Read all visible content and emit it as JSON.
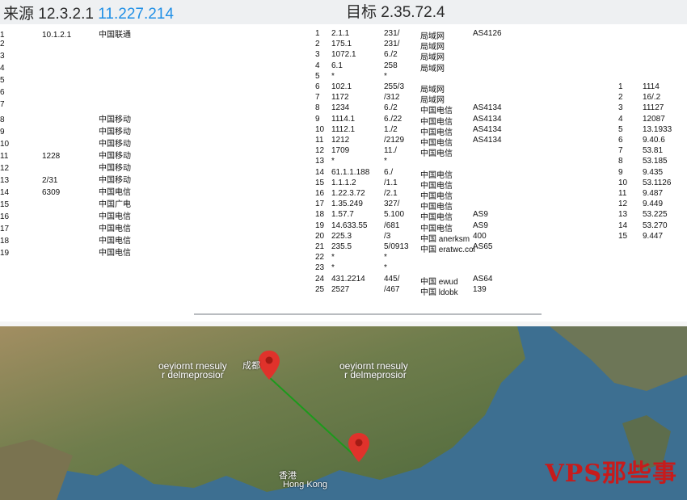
{
  "header": {
    "source_prefix": "来源",
    "source_ip_plain": "12.3.2.1",
    "source_ip_highlight": "11.227.214",
    "target_prefix": "目标",
    "target_ip": "2.35.72.4"
  },
  "left_table": [
    {
      "hop": "1",
      "ip": "10.1.2.1",
      "asn": "",
      "isp": "中国联通"
    },
    {
      "hop": "2",
      "ip": "",
      "asn": "",
      "isp": ""
    },
    {
      "hop": "3",
      "ip": "",
      "asn": "",
      "isp": ""
    },
    {
      "hop": "4",
      "ip": "",
      "asn": "",
      "isp": ""
    },
    {
      "hop": "5",
      "ip": "",
      "asn": "",
      "isp": ""
    },
    {
      "hop": "6",
      "ip": "",
      "asn": "",
      "isp": ""
    },
    {
      "hop": "7",
      "ip": "",
      "asn": "",
      "isp": ""
    },
    {
      "hop": "8",
      "ip": "",
      "asn": "",
      "isp": "中国移动"
    },
    {
      "hop": "9",
      "ip": "",
      "asn": "",
      "isp": "中国移动"
    },
    {
      "hop": "10",
      "ip": "",
      "asn": "",
      "isp": "中国移动"
    },
    {
      "hop": "11",
      "ip": "1228",
      "asn": "",
      "isp": "中国移动"
    },
    {
      "hop": "12",
      "ip": "",
      "asn": "",
      "isp": "中国移动"
    },
    {
      "hop": "13",
      "ip": "2/31",
      "asn": "",
      "isp": "中国移动"
    },
    {
      "hop": "14",
      "ip": "6309",
      "asn": "",
      "isp": "中国电信"
    },
    {
      "hop": "15",
      "ip": "",
      "asn": "",
      "isp": "中国广电"
    },
    {
      "hop": "16",
      "ip": "",
      "asn": "",
      "isp": "中国电信"
    },
    {
      "hop": "17",
      "ip": "",
      "asn": "",
      "isp": "中国电信"
    },
    {
      "hop": "18",
      "ip": "",
      "asn": "",
      "isp": "中国电信"
    },
    {
      "hop": "19",
      "ip": "",
      "asn": "",
      "isp": "中国电信"
    }
  ],
  "right_table": [
    {
      "hop": "1",
      "ip": "2.1.1",
      "rtt": "231/",
      "asn": "AS4126",
      "isp": "局域网"
    },
    {
      "hop": "2",
      "ip": "175.1",
      "rtt": "231/",
      "asn": "",
      "isp": "局域网"
    },
    {
      "hop": "3",
      "ip": "1072.1",
      "rtt": "6./2",
      "asn": "",
      "isp": "局域网"
    },
    {
      "hop": "4",
      "ip": "6.1",
      "rtt": "258",
      "asn": "",
      "isp": "局域网"
    },
    {
      "hop": "5",
      "ip": "*",
      "rtt": "*",
      "asn": "",
      "isp": ""
    },
    {
      "hop": "6",
      "ip": "102.1",
      "rtt": "255/3",
      "asn": "",
      "isp": "局域网"
    },
    {
      "hop": "7",
      "ip": "1172",
      "rtt": "/312",
      "asn": "",
      "isp": "局域网"
    },
    {
      "hop": "8",
      "ip": "1234",
      "rtt": "6./2",
      "asn": "AS4134",
      "isp": "中国电信"
    },
    {
      "hop": "9",
      "ip": "1114.1",
      "rtt": "6./22",
      "asn": "AS4134",
      "isp": "中国电信"
    },
    {
      "hop": "10",
      "ip": "1112.1",
      "rtt": "1./2",
      "asn": "AS4134",
      "isp": "中国电信"
    },
    {
      "hop": "11",
      "ip": "1212",
      "rtt": "/2129",
      "asn": "AS4134",
      "isp": "中国电信"
    },
    {
      "hop": "12",
      "ip": "1709",
      "rtt": "11./",
      "asn": "",
      "isp": "中国电信"
    },
    {
      "hop": "13",
      "ip": "*",
      "rtt": "*",
      "asn": "",
      "isp": ""
    },
    {
      "hop": "14",
      "ip": "61.1.1.188",
      "rtt": "6./",
      "asn": "",
      "isp": "中国电信"
    },
    {
      "hop": "15",
      "ip": "1.1.1.2",
      "rtt": "/1.1",
      "asn": "",
      "isp": "中国电信"
    },
    {
      "hop": "16",
      "ip": "1.22.3.72",
      "rtt": "/2.1",
      "asn": "",
      "isp": "中国电信"
    },
    {
      "hop": "17",
      "ip": "1.35.249",
      "rtt": "327/",
      "asn": "",
      "isp": "中国电信"
    },
    {
      "hop": "18",
      "ip": "1.57.7",
      "rtt": "5.100",
      "asn": "AS9",
      "isp": "中国电信"
    },
    {
      "hop": "19",
      "ip": "14.633.55",
      "rtt": "/681",
      "asn": "AS9",
      "isp": "中国电信"
    },
    {
      "hop": "20",
      "ip": "225.3",
      "rtt": "/3",
      "asn": "400",
      "isp": "中国 anerksm"
    },
    {
      "hop": "21",
      "ip": "235.5",
      "rtt": "5/0913",
      "asn": "AS65",
      "isp": "中国 eratwc.col"
    },
    {
      "hop": "22",
      "ip": "*",
      "rtt": "*",
      "asn": "",
      "isp": ""
    },
    {
      "hop": "23",
      "ip": "*",
      "rtt": "*",
      "asn": "",
      "isp": ""
    },
    {
      "hop": "24",
      "ip": "431.2214",
      "rtt": "445/",
      "asn": "AS64",
      "isp": "中国 ewud"
    },
    {
      "hop": "25",
      "ip": "2527",
      "rtt": "/467",
      "asn": "139",
      "isp": "中国 ldobk"
    }
  ],
  "far_right": [
    {
      "a": "1",
      "b": "1114"
    },
    {
      "a": "2",
      "b": "16/.2"
    },
    {
      "a": "3",
      "b": "11127"
    },
    {
      "a": "4",
      "b": "12087"
    },
    {
      "a": "5",
      "b": "13.1933"
    },
    {
      "a": "6",
      "b": "9.40.6"
    },
    {
      "a": "7",
      "b": "53.81"
    },
    {
      "a": "8",
      "b": "53.185"
    },
    {
      "a": "9",
      "b": "9.435"
    },
    {
      "a": "10",
      "b": "53.1126"
    },
    {
      "a": "11",
      "b": "9.487"
    },
    {
      "a": "12",
      "b": "9.449"
    },
    {
      "a": "13",
      "b": "53.225"
    },
    {
      "a": "14",
      "b": "53.270"
    },
    {
      "a": "15",
      "b": "9.447"
    }
  ],
  "map": {
    "overlay_labels": [
      "oeyiornt rnesuly",
      "r delmeprosior",
      "oeyiornt rnesuly",
      "r delmeprosior"
    ],
    "origin_city": "成都",
    "dest_city": "Hong Kong",
    "dest_label": "香港",
    "watermark": "VPS那些事",
    "colors": {
      "pin": "#e0322b",
      "route": "#1c9a1c",
      "sea": "#3d6f91",
      "land": "#6d7c4e"
    }
  }
}
